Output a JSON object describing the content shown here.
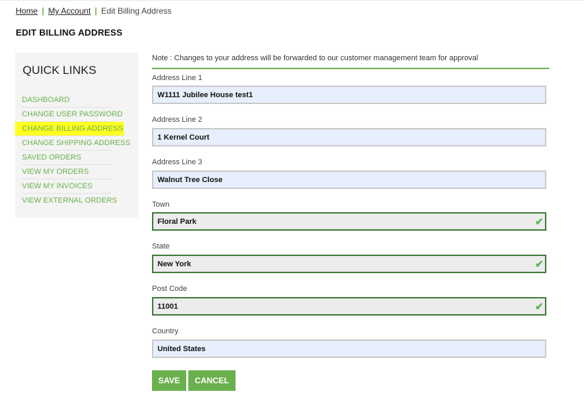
{
  "breadcrumb": {
    "home": "Home",
    "account": "My Account",
    "current": "Edit Billing Address",
    "separator": "|"
  },
  "page_title": "EDIT BILLING ADDRESS",
  "sidebar": {
    "title": "QUICK LINKS",
    "items": [
      {
        "label": "DASHBOARD"
      },
      {
        "label": "CHANGE USER PASSWORD"
      },
      {
        "label": "CHANGE BILLING ADDRESS"
      },
      {
        "label": "CHANGE SHIPPING ADDRESS"
      },
      {
        "label": "SAVED ORDERS"
      },
      {
        "label": "VIEW MY ORDERS"
      },
      {
        "label": "VIEW MY INVOICES"
      },
      {
        "label": "VIEW EXTERNAL ORDERS"
      }
    ],
    "active_item": "CHANGE BILLING ADDRESS",
    "highlight_color": "#ffff22"
  },
  "form": {
    "note": "Note : Changes to your address will be forwarded to our customer management team for approval",
    "fields": {
      "address1": {
        "label": "Address Line 1",
        "value": "W1111 Jubilee House test1"
      },
      "address2": {
        "label": "Address Line 2",
        "value": "1 Kernel Court"
      },
      "address3": {
        "label": "Address Line 3",
        "value": "Walnut Tree Close"
      },
      "town": {
        "label": "Town",
        "value": "Floral Park",
        "valid": true
      },
      "state": {
        "label": "State",
        "value": "New York",
        "valid": true
      },
      "postcode": {
        "label": "Post Code",
        "value": "11001",
        "valid": true
      },
      "country": {
        "label": "Country",
        "value": "United States"
      }
    },
    "check_glyph": "✔",
    "save_label": "SAVE",
    "cancel_label": "CANCEL"
  },
  "colors": {
    "accent": "#6ab04c",
    "valid_border": "#3f7a3a",
    "input_bg": "#e8effc"
  }
}
